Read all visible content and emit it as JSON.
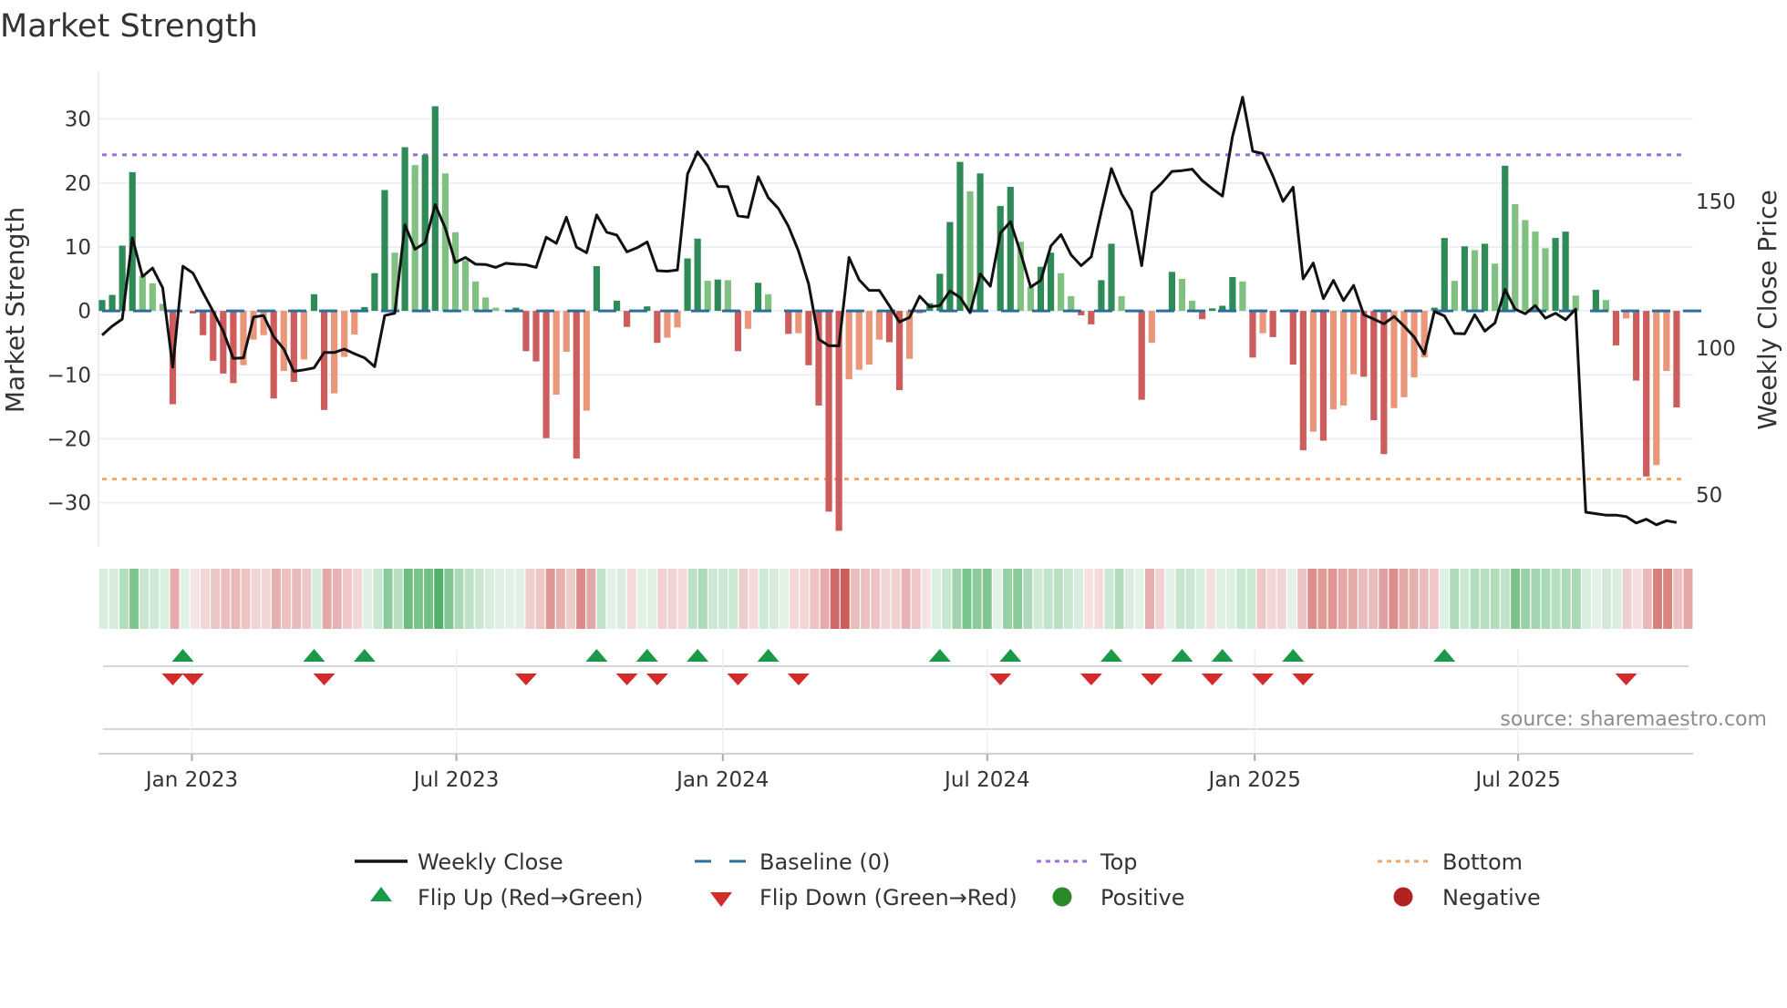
{
  "chart_data": {
    "type": "bar",
    "title": "Market Strength",
    "ylabel": "Market Strength",
    "y2label": "Weekly Close Price",
    "ylim": [
      -36.9,
      37.5
    ],
    "y2lim": [
      32.3,
      194.4
    ],
    "yticks": [
      -30,
      -20,
      -10,
      0,
      10,
      20,
      30
    ],
    "ytick_labels": [
      "−30",
      "−20",
      "−10",
      "0",
      "10",
      "20",
      "30"
    ],
    "y2ticks": [
      50,
      100,
      150
    ],
    "y2tick_labels": [
      "50",
      "100",
      "150"
    ],
    "x_unit": "week index",
    "xticks": [
      8.9,
      35.1,
      61.5,
      87.7,
      114.2,
      140.3
    ],
    "xtick_labels": [
      "Jan 2023",
      "Jul 2023",
      "Jan 2024",
      "Jul 2024",
      "Jan 2025",
      "Jul 2025"
    ],
    "top_level": 24.4,
    "bottom_level": -26.3,
    "grid": true,
    "legend_placement": "bottom-center",
    "series": [
      {
        "name": "Market Strength",
        "type": "bar",
        "values": [
          1.7,
          2.5,
          10.2,
          21.7,
          5.5,
          4.3,
          1.1,
          -14.6,
          0,
          -0.4,
          -3.8,
          -7.8,
          -9.8,
          -11.3,
          -8.5,
          -4.5,
          -3.8,
          -13.7,
          -9.4,
          -11.1,
          -7.6,
          2.6,
          -15.5,
          -12.9,
          -7.2,
          -3.7,
          0.6,
          5.9,
          18.9,
          9.1,
          25.6,
          22.8,
          24.4,
          32,
          21.5,
          12.3,
          7.9,
          4.6,
          2.1,
          0.5,
          0.1,
          0.5,
          -6.3,
          -7.9,
          -19.9,
          -13.1,
          -6.4,
          -23.1,
          -15.6,
          7.0,
          0.1,
          1.6,
          -2.5,
          0,
          0.7,
          -5.0,
          -4.2,
          -2.6,
          8.2,
          11.3,
          4.7,
          4.9,
          4.8,
          -6.3,
          -2.8,
          4.4,
          2.6,
          0,
          -3.6,
          -3.5,
          -8.5,
          -14.8,
          -31.4,
          -34.4,
          -10.7,
          -9.2,
          -8.4,
          -4.5,
          -4.9,
          -12.4,
          -7.5,
          -0.4,
          1.2,
          5.8,
          13.9,
          23.3,
          18.7,
          21.5,
          0,
          16.4,
          19.4,
          10.8,
          3.8,
          6.9,
          9.1,
          5.9,
          2.3,
          -0.7,
          -2.1,
          4.8,
          10.5,
          2.3,
          0.1,
          -13.9,
          -5.0,
          0,
          6.1,
          5.0,
          1.6,
          -1.3,
          0.4,
          0.8,
          5.3,
          4.6,
          -7.3,
          -3.5,
          -4.1,
          0,
          -8.4,
          -21.8,
          -18.9,
          -20.3,
          -15.4,
          -14.8,
          -9.9,
          -10.3,
          -17.1,
          -22.4,
          -15.2,
          -13.5,
          -10.4,
          -7.3,
          0.5,
          11.4,
          4.7,
          10.1,
          9.5,
          10.5,
          7.4,
          22.7,
          16.7,
          14.2,
          12.4,
          9.8,
          11.4,
          12.4,
          2.4,
          0,
          3.3,
          1.7,
          -5.4,
          -1.2,
          -10.9,
          -25.9,
          -24.1,
          -9.4,
          -15.1
        ]
      },
      {
        "name": "Weekly Close",
        "type": "line",
        "axis": "right",
        "values": [
          104.4,
          107.5,
          109.9,
          137.6,
          124.4,
          127.3,
          120.6,
          93.5,
          127.9,
          125.6,
          118.9,
          112.5,
          105.8,
          96.5,
          96.7,
          110.6,
          111.1,
          103.9,
          99.7,
          92.1,
          92.6,
          93.3,
          98.5,
          98.5,
          99.7,
          98.1,
          96.7,
          93.7,
          111.1,
          111.9,
          142.0,
          133.7,
          135.9,
          148.9,
          140.9,
          129.2,
          130.9,
          128.6,
          128.5,
          127.5,
          128.9,
          128.6,
          128.4,
          127.5,
          137.8,
          135.7,
          144.6,
          134.4,
          132.5,
          145.4,
          139.5,
          138.5,
          132.8,
          134.2,
          136.2,
          126.4,
          126.2,
          126.6,
          159.3,
          166.9,
          162.1,
          155.1,
          155.0,
          145.1,
          144.6,
          158.4,
          151.3,
          147.6,
          141.5,
          133.1,
          121.9,
          103.0,
          100.8,
          100.8,
          130.9,
          123.3,
          119.7,
          119.7,
          114.4,
          108.9,
          110.5,
          117.7,
          114.1,
          114.5,
          119.5,
          117.3,
          112.1,
          125.3,
          121.1,
          139.2,
          143.1,
          132.5,
          120.8,
          123.1,
          134.8,
          138.7,
          131.8,
          128.1,
          131.1,
          146.5,
          161.2,
          152.6,
          146.8,
          128.1,
          152.9,
          156.3,
          160.2,
          160.5,
          161.0,
          157.1,
          154.3,
          151.8,
          172.1,
          185.5,
          167.1,
          166.3,
          158.7,
          150.0,
          154.8,
          123.6,
          129.0,
          116.9,
          123.1,
          116.2,
          121.4,
          111.4,
          109.9,
          108.3,
          110.8,
          107.5,
          103.8,
          98.0,
          112.5,
          111.0,
          105.0,
          104.9,
          111.4,
          105.8,
          108.6,
          120.0,
          113.3,
          111.7,
          114.5,
          110.2,
          111.9,
          109.7,
          113.3,
          44.1,
          43.6,
          43.1,
          43.1,
          42.6,
          40.4,
          41.7,
          39.8,
          41.2,
          40.6
        ]
      }
    ],
    "flip_up_weeks": [
      8,
      21,
      26,
      49,
      54,
      59,
      66,
      83,
      90,
      100,
      107,
      111,
      118,
      133
    ],
    "flip_down_weeks": [
      7,
      9,
      22,
      42,
      52,
      55,
      63,
      69,
      89,
      98,
      104,
      110,
      115,
      119,
      151
    ],
    "legend": [
      {
        "label": "Weekly Close",
        "kind": "line-solid",
        "color": "#111111"
      },
      {
        "label": "Baseline (0)",
        "kind": "line-dash",
        "color": "#2c6e9b"
      },
      {
        "label": "Top",
        "kind": "line-dot",
        "color": "#9b6ee0"
      },
      {
        "label": "Bottom",
        "kind": "line-dot",
        "color": "#f2a766"
      },
      {
        "label": "Flip Up (Red→Green)",
        "kind": "triangle-up",
        "color": "#1a9a47"
      },
      {
        "label": "Flip Down (Green→Red)",
        "kind": "triangle-down",
        "color": "#d62a2a"
      },
      {
        "label": "Positive",
        "kind": "dot",
        "color": "#2a8a2a"
      },
      {
        "label": "Negative",
        "kind": "dot",
        "color": "#b22222"
      }
    ],
    "colors": {
      "pos_strong": "#2e8b57",
      "pos_weak": "#80c080",
      "neg_strong": "#cd5c5c",
      "neg_weak": "#e9967a",
      "heat_pos": "#3aa655",
      "heat_neg": "#c9524f",
      "grid": "#eceff3",
      "line": "#111111"
    },
    "source": "source: sharemaestro.com"
  }
}
